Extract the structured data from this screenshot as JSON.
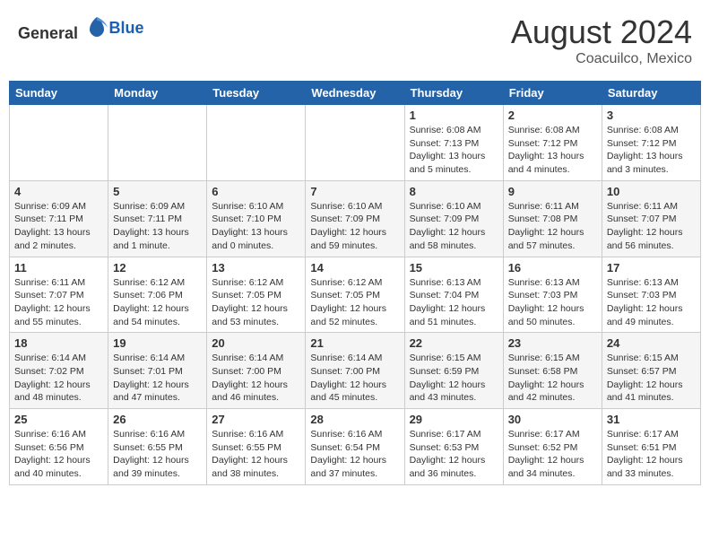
{
  "header": {
    "logo_general": "General",
    "logo_blue": "Blue",
    "month_year": "August 2024",
    "location": "Coacuilco, Mexico"
  },
  "weekdays": [
    "Sunday",
    "Monday",
    "Tuesday",
    "Wednesday",
    "Thursday",
    "Friday",
    "Saturday"
  ],
  "weeks": [
    [
      {
        "day": "",
        "info": ""
      },
      {
        "day": "",
        "info": ""
      },
      {
        "day": "",
        "info": ""
      },
      {
        "day": "",
        "info": ""
      },
      {
        "day": "1",
        "info": "Sunrise: 6:08 AM\nSunset: 7:13 PM\nDaylight: 13 hours\nand 5 minutes."
      },
      {
        "day": "2",
        "info": "Sunrise: 6:08 AM\nSunset: 7:12 PM\nDaylight: 13 hours\nand 4 minutes."
      },
      {
        "day": "3",
        "info": "Sunrise: 6:08 AM\nSunset: 7:12 PM\nDaylight: 13 hours\nand 3 minutes."
      }
    ],
    [
      {
        "day": "4",
        "info": "Sunrise: 6:09 AM\nSunset: 7:11 PM\nDaylight: 13 hours\nand 2 minutes."
      },
      {
        "day": "5",
        "info": "Sunrise: 6:09 AM\nSunset: 7:11 PM\nDaylight: 13 hours\nand 1 minute."
      },
      {
        "day": "6",
        "info": "Sunrise: 6:10 AM\nSunset: 7:10 PM\nDaylight: 13 hours\nand 0 minutes."
      },
      {
        "day": "7",
        "info": "Sunrise: 6:10 AM\nSunset: 7:09 PM\nDaylight: 12 hours\nand 59 minutes."
      },
      {
        "day": "8",
        "info": "Sunrise: 6:10 AM\nSunset: 7:09 PM\nDaylight: 12 hours\nand 58 minutes."
      },
      {
        "day": "9",
        "info": "Sunrise: 6:11 AM\nSunset: 7:08 PM\nDaylight: 12 hours\nand 57 minutes."
      },
      {
        "day": "10",
        "info": "Sunrise: 6:11 AM\nSunset: 7:07 PM\nDaylight: 12 hours\nand 56 minutes."
      }
    ],
    [
      {
        "day": "11",
        "info": "Sunrise: 6:11 AM\nSunset: 7:07 PM\nDaylight: 12 hours\nand 55 minutes."
      },
      {
        "day": "12",
        "info": "Sunrise: 6:12 AM\nSunset: 7:06 PM\nDaylight: 12 hours\nand 54 minutes."
      },
      {
        "day": "13",
        "info": "Sunrise: 6:12 AM\nSunset: 7:05 PM\nDaylight: 12 hours\nand 53 minutes."
      },
      {
        "day": "14",
        "info": "Sunrise: 6:12 AM\nSunset: 7:05 PM\nDaylight: 12 hours\nand 52 minutes."
      },
      {
        "day": "15",
        "info": "Sunrise: 6:13 AM\nSunset: 7:04 PM\nDaylight: 12 hours\nand 51 minutes."
      },
      {
        "day": "16",
        "info": "Sunrise: 6:13 AM\nSunset: 7:03 PM\nDaylight: 12 hours\nand 50 minutes."
      },
      {
        "day": "17",
        "info": "Sunrise: 6:13 AM\nSunset: 7:03 PM\nDaylight: 12 hours\nand 49 minutes."
      }
    ],
    [
      {
        "day": "18",
        "info": "Sunrise: 6:14 AM\nSunset: 7:02 PM\nDaylight: 12 hours\nand 48 minutes."
      },
      {
        "day": "19",
        "info": "Sunrise: 6:14 AM\nSunset: 7:01 PM\nDaylight: 12 hours\nand 47 minutes."
      },
      {
        "day": "20",
        "info": "Sunrise: 6:14 AM\nSunset: 7:00 PM\nDaylight: 12 hours\nand 46 minutes."
      },
      {
        "day": "21",
        "info": "Sunrise: 6:14 AM\nSunset: 7:00 PM\nDaylight: 12 hours\nand 45 minutes."
      },
      {
        "day": "22",
        "info": "Sunrise: 6:15 AM\nSunset: 6:59 PM\nDaylight: 12 hours\nand 43 minutes."
      },
      {
        "day": "23",
        "info": "Sunrise: 6:15 AM\nSunset: 6:58 PM\nDaylight: 12 hours\nand 42 minutes."
      },
      {
        "day": "24",
        "info": "Sunrise: 6:15 AM\nSunset: 6:57 PM\nDaylight: 12 hours\nand 41 minutes."
      }
    ],
    [
      {
        "day": "25",
        "info": "Sunrise: 6:16 AM\nSunset: 6:56 PM\nDaylight: 12 hours\nand 40 minutes."
      },
      {
        "day": "26",
        "info": "Sunrise: 6:16 AM\nSunset: 6:55 PM\nDaylight: 12 hours\nand 39 minutes."
      },
      {
        "day": "27",
        "info": "Sunrise: 6:16 AM\nSunset: 6:55 PM\nDaylight: 12 hours\nand 38 minutes."
      },
      {
        "day": "28",
        "info": "Sunrise: 6:16 AM\nSunset: 6:54 PM\nDaylight: 12 hours\nand 37 minutes."
      },
      {
        "day": "29",
        "info": "Sunrise: 6:17 AM\nSunset: 6:53 PM\nDaylight: 12 hours\nand 36 minutes."
      },
      {
        "day": "30",
        "info": "Sunrise: 6:17 AM\nSunset: 6:52 PM\nDaylight: 12 hours\nand 34 minutes."
      },
      {
        "day": "31",
        "info": "Sunrise: 6:17 AM\nSunset: 6:51 PM\nDaylight: 12 hours\nand 33 minutes."
      }
    ]
  ]
}
